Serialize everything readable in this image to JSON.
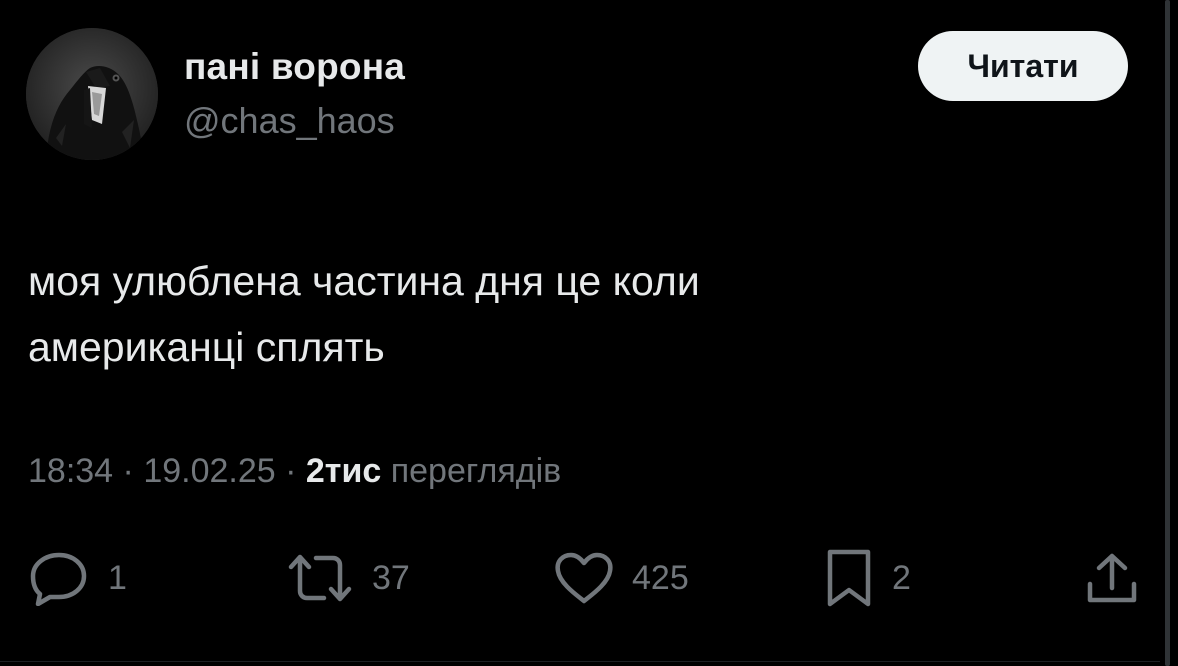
{
  "author": {
    "display_name": "пані ворона",
    "handle": "@chas_haos"
  },
  "follow_button": {
    "label": "Читати"
  },
  "tweet": {
    "text": "моя улюблена частина дня це коли\nамериканці сплять"
  },
  "meta": {
    "time": "18:34",
    "separator1": " · ",
    "date": "19.02.25",
    "separator2": " · ",
    "views_count": "2тис",
    "views_label": " переглядів"
  },
  "actions": {
    "replies": "1",
    "reposts": "37",
    "likes": "425",
    "bookmarks": "2"
  },
  "colors": {
    "background": "#000000",
    "primary_text": "#e7e9ea",
    "secondary_text": "#71767b",
    "button_bg": "#eff3f4"
  },
  "icons": {
    "reply": "reply-icon",
    "repost": "repost-icon",
    "like": "heart-icon",
    "bookmark": "bookmark-icon",
    "share": "share-icon"
  }
}
